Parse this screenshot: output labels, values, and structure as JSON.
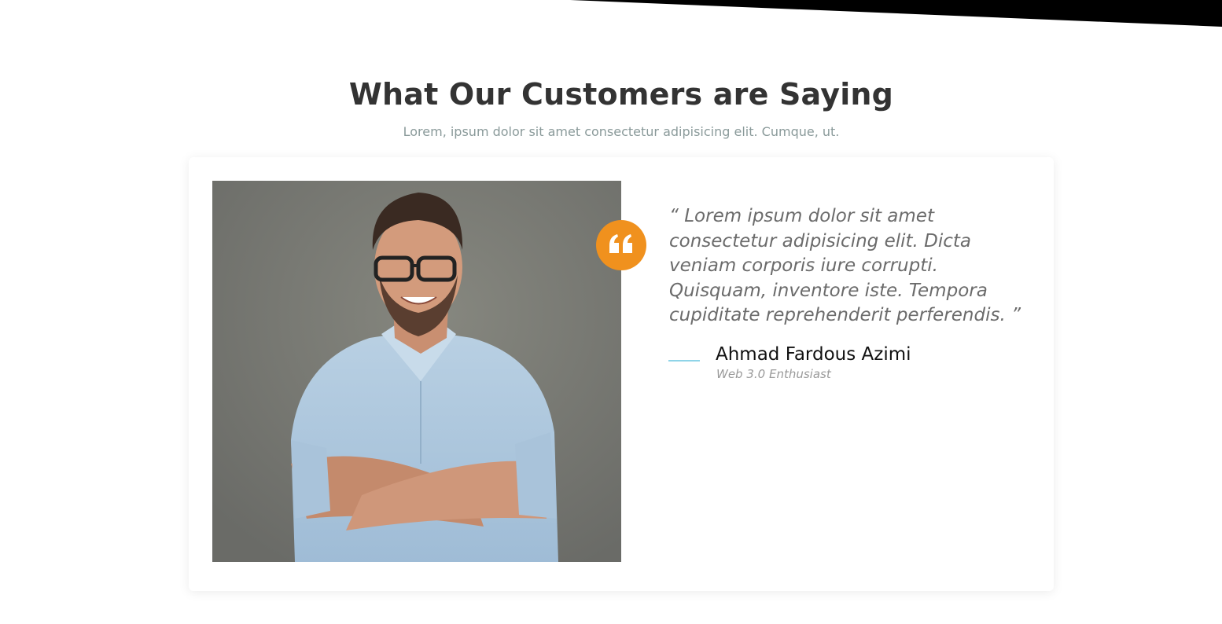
{
  "testimonials": {
    "title": "What Our Customers are Saying",
    "subtitle": "Lorem, ipsum dolor sit amet consectetur adipisicing elit. Cumque, ut.",
    "card": {
      "quote": "“ Lorem ipsum dolor sit amet consectetur adipisicing elit. Dicta veniam corporis iure corrupti. Quisquam, inventore iste. Tempora cupiditate reprehenderit perferendis. ”",
      "author_name": "Ahmad Fardous Azimi",
      "author_role": "Web 3.0 Enthusiast",
      "quote_icon": "quote-open-icon",
      "photo": "customer-portrait"
    }
  },
  "colors": {
    "accent": "#f0911e",
    "author_line": "#8fd4e8",
    "title": "#333333",
    "subtitle": "#8a9a9a",
    "quote_text": "#6b6b6b"
  }
}
